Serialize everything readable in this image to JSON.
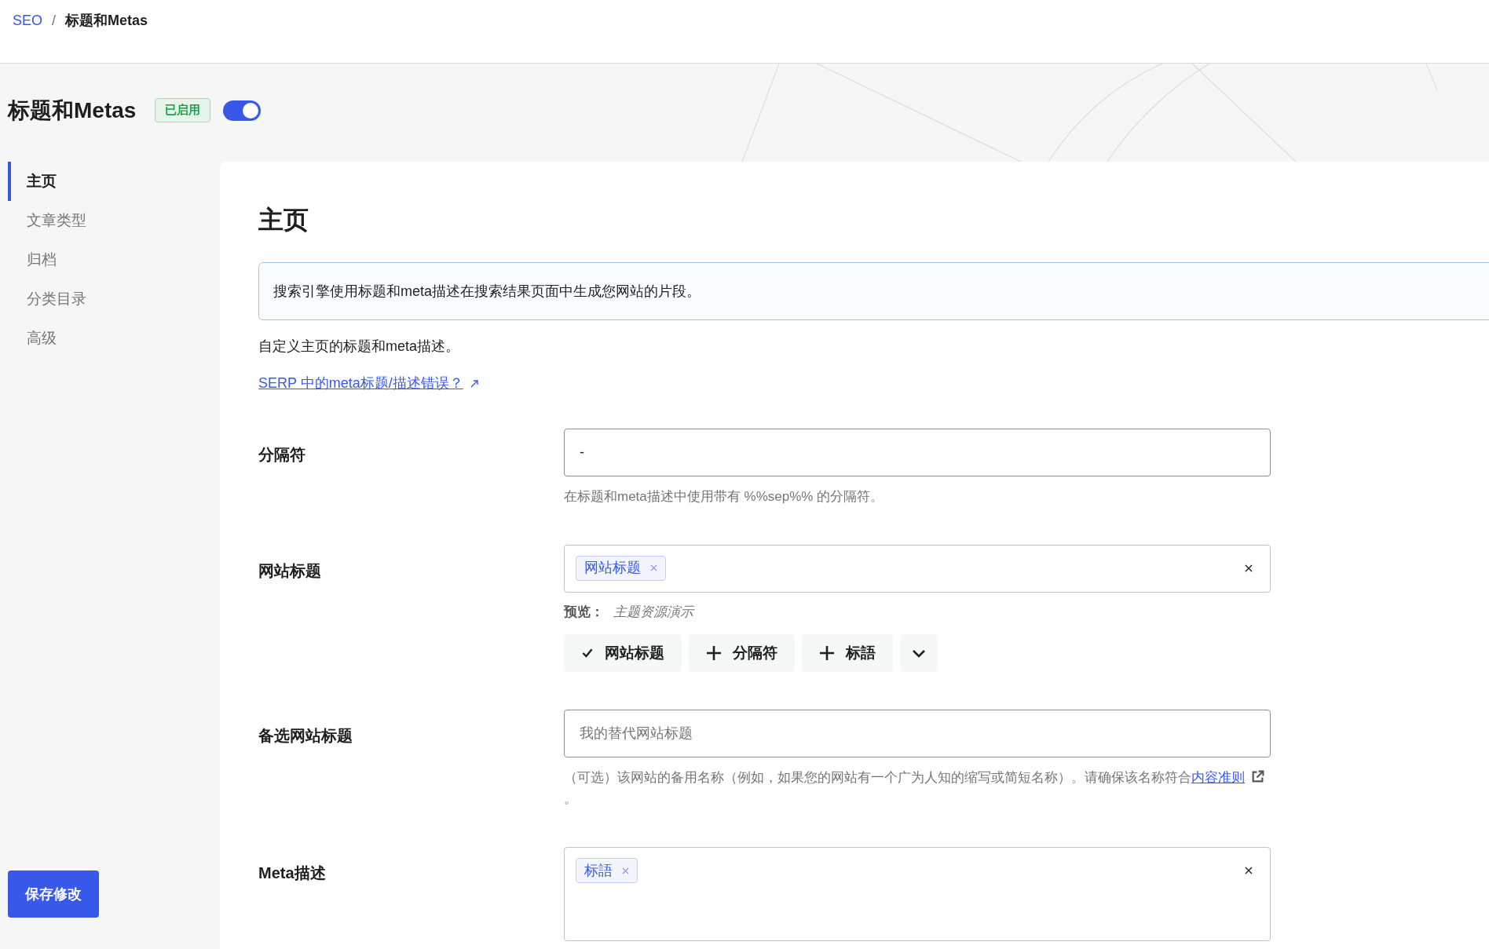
{
  "breadcrumb_separator": "/",
  "breadcrumb": [
    {
      "label": "SEO",
      "kind": "link"
    },
    {
      "label": "标题和Metas",
      "kind": "current"
    }
  ],
  "page": {
    "title": "标题和Metas",
    "badge": "已启用",
    "toggle_on": true
  },
  "sidebar": {
    "items": [
      {
        "label": "主页",
        "selected": true
      },
      {
        "label": "文章类型",
        "selected": false
      },
      {
        "label": "归档",
        "selected": false
      },
      {
        "label": "分类目录",
        "selected": false
      },
      {
        "label": "高级",
        "selected": false
      }
    ]
  },
  "save_button": "保存修改",
  "panel": {
    "heading": "主页",
    "info": "搜索引擎使用标题和meta描述在搜索结果页面中生成您网站的片段。",
    "description": "自定义主页的标题和meta描述。",
    "help_link": "SERP 中的meta标题/描述错误？",
    "fields": [
      {
        "kind": "text",
        "label": "分隔符",
        "value": "-",
        "help": "在标题和meta描述中使用带有 %%sep%% 的分隔符。"
      },
      {
        "kind": "tags",
        "label": "网站标题",
        "tags": [
          "网站标题"
        ],
        "preview_label": "预览：",
        "preview": "主题资源演示",
        "variables": [
          {
            "label": "网站标题",
            "added": true
          },
          {
            "label": "分隔符",
            "added": false
          },
          {
            "label": "标語",
            "added": false
          }
        ]
      },
      {
        "kind": "text",
        "label": "备选网站标题",
        "placeholder": "我的替代网站标题",
        "help": "（可选）该网站的备用名称（例如，如果您的网站有一个广为人知的缩写或简短名称）。请确保该名称符合",
        "help_link": "内容准则",
        "help_end": "。"
      },
      {
        "kind": "textarea-tags",
        "label": "Meta描述",
        "tags": [
          "标語"
        ]
      }
    ]
  }
}
